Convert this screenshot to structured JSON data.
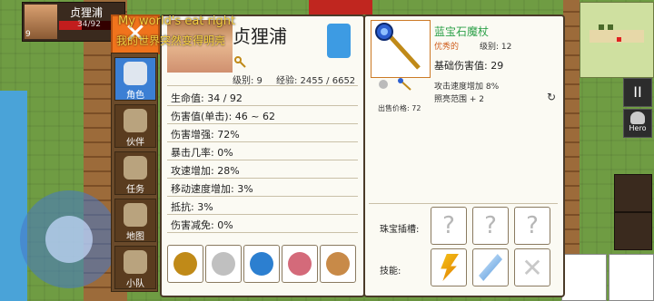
{
  "player_card": {
    "name": "贞狸浦",
    "level": "9",
    "hp_text": "34/92",
    "hp_fraction": 0.37
  },
  "close_label": "✕",
  "menu": [
    {
      "label": "角色",
      "icon": "helmet-icon",
      "active": true
    },
    {
      "label": "伙伴",
      "icon": "rock-icon",
      "active": false
    },
    {
      "label": "任务",
      "icon": "trophy-icon",
      "active": false
    },
    {
      "label": "地图",
      "icon": "scroll-map-icon",
      "active": false
    },
    {
      "label": "小队",
      "icon": "party-icon",
      "active": false
    }
  ],
  "character": {
    "name": "贞狸浦",
    "level_label": "级别: 9",
    "exp_label": "经验: 2455 / 6652",
    "stats": [
      "生命值: 34 / 92",
      "伤害值(单击): 46 ~ 62",
      "伤害增强: 72%",
      "暴击几率: 0%",
      "攻速增加: 28%",
      "移动速度增加: 3%",
      "抵抗: 3%",
      "伤害减免: 0%"
    ],
    "equipment": [
      "staff-icon",
      "armor-icon",
      "ring-icon",
      "amulet-icon",
      "glove-icon"
    ]
  },
  "overlay": {
    "line1": "My world's eat right",
    "line2": "我的世界突然变得明亮"
  },
  "item": {
    "name": "蓝宝石魔杖",
    "quality": "优秀的",
    "level_label": "级别: 12",
    "base_damage": "基础伤害值: 29",
    "attack_speed": "攻击速度增加 8%",
    "light_range": "照亮范围 + 2",
    "sell_price": "出售价格: 72",
    "socket_label": "珠宝插槽:",
    "skill_label": "技能:",
    "sockets": [
      "?",
      "?",
      "?"
    ],
    "skills": [
      "lightning-icon",
      "ice-shard-icon",
      "locked-icon"
    ]
  },
  "colors": {
    "accent_orange": "#f0731c",
    "item_green": "#2ea14a",
    "quality_orange": "#d06020"
  },
  "hud": {
    "pause_label": "II",
    "hero_label": "Hero"
  }
}
